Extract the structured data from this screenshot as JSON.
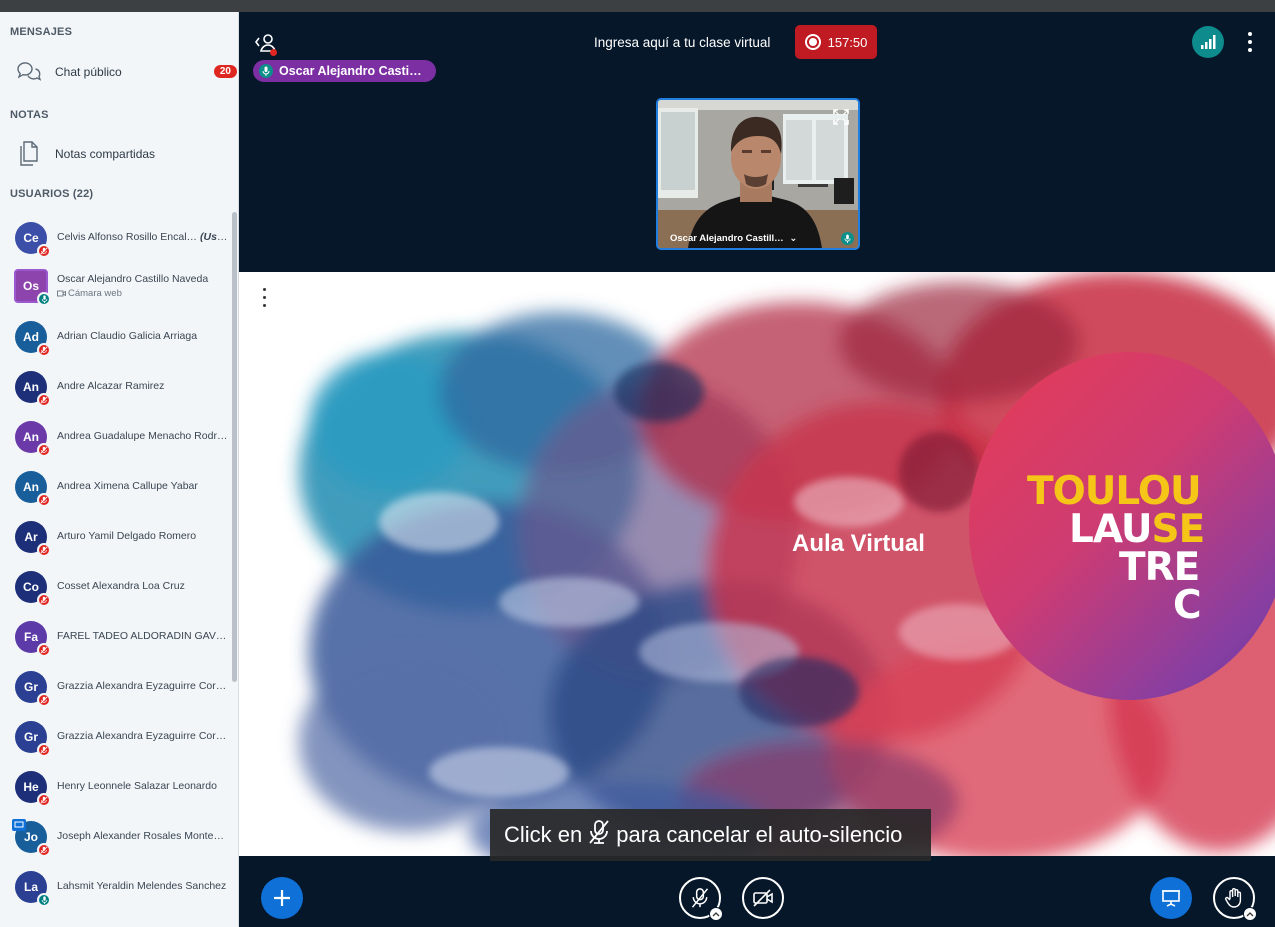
{
  "sidebar": {
    "messages_title": "MENSAJES",
    "public_chat": {
      "label": "Chat público",
      "count": "20"
    },
    "notes_title": "NOTAS",
    "shared_notes": "Notas compartidas",
    "users_title": "USUARIOS (22)",
    "users": [
      {
        "initials": "Ce",
        "name": "Celvis Alfonso Rosillo Encal…",
        "suffix": "(Usted)",
        "color": "#3b4fa8",
        "mic": "muted"
      },
      {
        "initials": "Os",
        "name": "Oscar Alejandro Castillo Naveda",
        "sub": "Cámara web",
        "color": "#8e44ad",
        "mic": "on",
        "presenter_box": true
      },
      {
        "initials": "Ad",
        "name": "Adrian Claudio Galicia Arriaga",
        "color": "#175e9b",
        "mic": "muted"
      },
      {
        "initials": "An",
        "name": "Andre Alcazar Ramirez",
        "color": "#1d2f78",
        "mic": "muted"
      },
      {
        "initials": "An",
        "name": "Andrea Guadalupe Menacho Rodri…",
        "color": "#6b3aa8",
        "mic": "muted"
      },
      {
        "initials": "An",
        "name": "Andrea Ximena Callupe Yabar",
        "color": "#175e9b",
        "mic": "muted"
      },
      {
        "initials": "Ar",
        "name": "Arturo Yamil Delgado Romero",
        "color": "#1d2f78",
        "mic": "muted"
      },
      {
        "initials": "Co",
        "name": "Cosset Alexandra Loa Cruz",
        "color": "#1d2f78",
        "mic": "muted"
      },
      {
        "initials": "Fa",
        "name": "FAREL TADEO ALDORADIN GAVIRIA",
        "color": "#5c3aa8",
        "mic": "muted"
      },
      {
        "initials": "Gr",
        "name": "Grazzia Alexandra Eyzaguirre Correa",
        "color": "#2b3f93",
        "mic": "muted"
      },
      {
        "initials": "Gr",
        "name": "Grazzia Alexandra Eyzaguirre Correa",
        "color": "#2b3f93",
        "mic": "muted"
      },
      {
        "initials": "He",
        "name": "Henry Leonnele Salazar Leonardo",
        "color": "#1d2f78",
        "mic": "muted"
      },
      {
        "initials": "Jo",
        "name": "Joseph Alexander Rosales Monten…",
        "color": "#175e9b",
        "mic": "muted",
        "presenter": true
      },
      {
        "initials": "La",
        "name": "Lahsmit Yeraldin Melendes Sanchez",
        "color": "#2b3f93",
        "mic": "on"
      }
    ]
  },
  "topbar": {
    "meeting_title": "Ingresa aquí a tu clase virtual",
    "recording_time": "157:50",
    "talking_indicator": "Oscar Alejandro Casti…"
  },
  "webcam": {
    "name": "Oscar Alejandro Castill…"
  },
  "slide": {
    "title": "Aula Virtual",
    "logo_lines": [
      {
        "parts": [
          {
            "t": "TOULOU",
            "c": "#f5c518"
          }
        ]
      },
      {
        "parts": [
          {
            "t": "LAU",
            "c": "#ffffff"
          },
          {
            "t": "SE",
            "c": "#f5c518"
          }
        ]
      },
      {
        "parts": [
          {
            "t": "TRE",
            "c": "#ffffff"
          }
        ]
      },
      {
        "parts": [
          {
            "t": "C",
            "c": "#ffffff"
          }
        ]
      }
    ]
  },
  "toast": {
    "before": "Click en",
    "after": "para cancelar el auto-silencio"
  },
  "colors": {
    "muted": "#df2721",
    "talking": "#008081",
    "accent": "#0f70d7",
    "recording": "#c01b22"
  }
}
